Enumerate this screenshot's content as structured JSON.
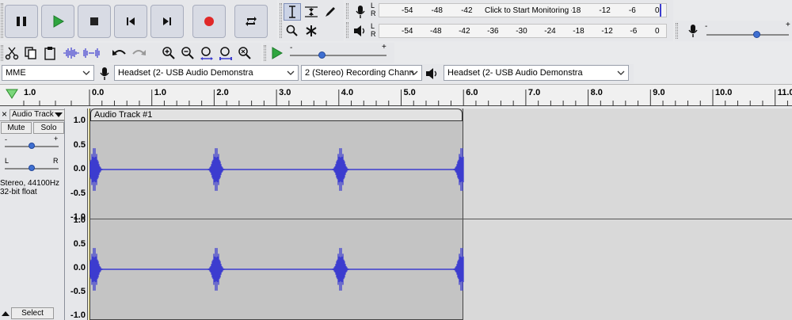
{
  "transport": {
    "pause_icon": "pause-icon",
    "play_icon": "play-icon",
    "stop_icon": "stop-icon",
    "skip_start_icon": "skip-to-start-icon",
    "skip_end_icon": "skip-to-end-icon",
    "record_icon": "record-icon",
    "loop_icon": "loop-icon",
    "colors": {
      "play": "#2fa53f",
      "record": "#e02828",
      "button_bg": "#d8dbe4"
    }
  },
  "meters": {
    "record_L": "L",
    "record_R": "R",
    "play_L": "L",
    "play_R": "R",
    "monitor_prompt": "Click to Start Monitoring",
    "record_scale": [
      "-54",
      "-48",
      "-42",
      "",
      "",
      "",
      "-18",
      "-12",
      "-6",
      "0"
    ],
    "play_scale": [
      "-54",
      "-48",
      "-42",
      "-36",
      "-30",
      "-24",
      "-18",
      "-12",
      "-6",
      "0"
    ]
  },
  "mixer": {
    "record_volume_minus": "-",
    "record_volume_plus": "+",
    "play_speed_minus": "-",
    "play_speed_plus": "+"
  },
  "device": {
    "host": "MME",
    "recording_device": "Headset (2- USB Audio Demonstra",
    "channels": "2 (Stereo) Recording Chann",
    "playback_device": "Headset (2- USB Audio Demonstra"
  },
  "timeline": {
    "ruler_labels": [
      "1.0",
      "0.0",
      "1.0",
      "2.0",
      "3.0",
      "4.0",
      "5.0",
      "6.0",
      "7.0",
      "8.0",
      "9.0",
      "10.0",
      "11.0"
    ]
  },
  "track": {
    "close_label": "×",
    "menu_label": "Audio Track",
    "mute_label": "Mute",
    "solo_label": "Solo",
    "gain_minus": "-",
    "gain_plus": "+",
    "pan_left": "L",
    "pan_right": "R",
    "info_line1": "Stereo, 44100Hz",
    "info_line2": "32-bit float",
    "select_label": "Select",
    "clip_name": "Audio Track #1",
    "amplitude_labels": [
      "1.0",
      "0.5",
      "0.0",
      "-0.5",
      "-1.0"
    ],
    "colors": {
      "waveform": "#3c3ccf",
      "clip_bg": "#c4c4c4",
      "clip_header": "#e2e2e2",
      "empty_bg": "#d9d9d9"
    }
  }
}
